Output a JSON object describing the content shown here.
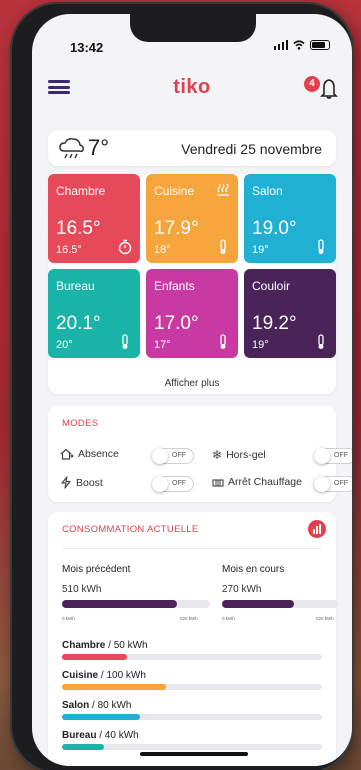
{
  "status": {
    "time": "13:42"
  },
  "app": {
    "logo": "tiko",
    "notification_count": "4",
    "accent": "#e2404e",
    "brand_purple": "#3b2a6e"
  },
  "weather": {
    "icon": "cloud-rain-icon",
    "temperature": "7°",
    "date": "Vendredi 25 novembre"
  },
  "rooms": [
    {
      "name": "Chambre",
      "temp": "16.5°",
      "setpoint": "16.5°",
      "icon": "timer-icon",
      "color": "#e5495a"
    },
    {
      "name": "Cuisine",
      "temp": "17.9°",
      "setpoint": "18°",
      "icon": "heating-icon",
      "color": "#f5a53c"
    },
    {
      "name": "Salon",
      "temp": "19.0°",
      "setpoint": "19°",
      "icon": "thermometer-icon",
      "color": "#1fb0d3"
    },
    {
      "name": "Bureau",
      "temp": "20.1°",
      "setpoint": "20°",
      "icon": "thermometer-icon",
      "color": "#1ab3a8"
    },
    {
      "name": "Enfants",
      "temp": "17.0°",
      "setpoint": "17°",
      "icon": "thermometer-icon",
      "color": "#c83aa2"
    },
    {
      "name": "Couloir",
      "temp": "19.2°",
      "setpoint": "19°",
      "icon": "thermometer-icon",
      "color": "#4a2459"
    }
  ],
  "more_label": "Afficher plus",
  "modes": {
    "title": "MODES",
    "items": [
      {
        "label": "Absence",
        "state": "OFF",
        "icon": "home-away-icon"
      },
      {
        "label": "Hors-gel",
        "state": "OFF",
        "icon": "snowflake-icon"
      },
      {
        "label": "Boost",
        "state": "OFF",
        "icon": "lightning-icon"
      },
      {
        "label": "Arrêt Chauffage",
        "state": "OFF",
        "icon": "heater-off-icon"
      }
    ]
  },
  "consumption": {
    "title": "CONSOMMATION ACTUELLE",
    "previous": {
      "label": "Mois précédent",
      "value": "510 kWh",
      "fraction": 0.78,
      "axis_min": "0 kWh",
      "axis_max": "520 kWh"
    },
    "current": {
      "label": "Mois en cours",
      "value": "270 kWh",
      "fraction": 0.62,
      "axis_min": "0 kWh",
      "axis_max": "520 kWh"
    },
    "rooms": [
      {
        "name": "Chambre",
        "value": " / 50 kWh",
        "fraction": 0.25,
        "color": "#e5495a"
      },
      {
        "name": "Cuisine",
        "value": " / 100 kWh",
        "fraction": 0.4,
        "color": "#f5a53c"
      },
      {
        "name": "Salon",
        "value": " / 80 kWh",
        "fraction": 0.3,
        "color": "#1fb0d3"
      },
      {
        "name": "Bureau",
        "value": " / 40 kWh",
        "fraction": 0.16,
        "color": "#1ab3a8"
      }
    ]
  }
}
